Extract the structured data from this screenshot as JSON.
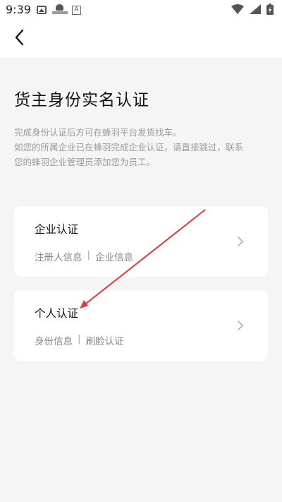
{
  "status_bar": {
    "time": "9:39",
    "left_icons": [
      "image-icon",
      "app-notification-icon",
      "text-a-icon"
    ],
    "right_icons": [
      "wifi-icon",
      "signal-icon",
      "battery-charging-icon"
    ]
  },
  "nav": {
    "back_icon": "back-arrow-icon"
  },
  "page": {
    "title": "货主身份实名认证",
    "description_lines": [
      "完成身份认证后方可在蜂羽平台发货找车。",
      "如您的所属企业已在蜂羽完成企业认证，请直接跳过，联系",
      "您的蜂羽企业管理员添加您为员工。"
    ]
  },
  "options": [
    {
      "title": "企业认证",
      "sub_items": [
        "注册人信息",
        "企业信息"
      ],
      "separator": "|",
      "chevron_icon": "chevron-right-icon"
    },
    {
      "title": "个人认证",
      "sub_items": [
        "身份信息",
        "刷脸认证"
      ],
      "separator": "|",
      "chevron_icon": "chevron-right-icon"
    }
  ],
  "colors": {
    "background": "#f5f5f5",
    "card": "#ffffff",
    "title_text": "#111111",
    "muted_text": "#9a9a9a",
    "annotation_arrow": "#e0393e"
  }
}
